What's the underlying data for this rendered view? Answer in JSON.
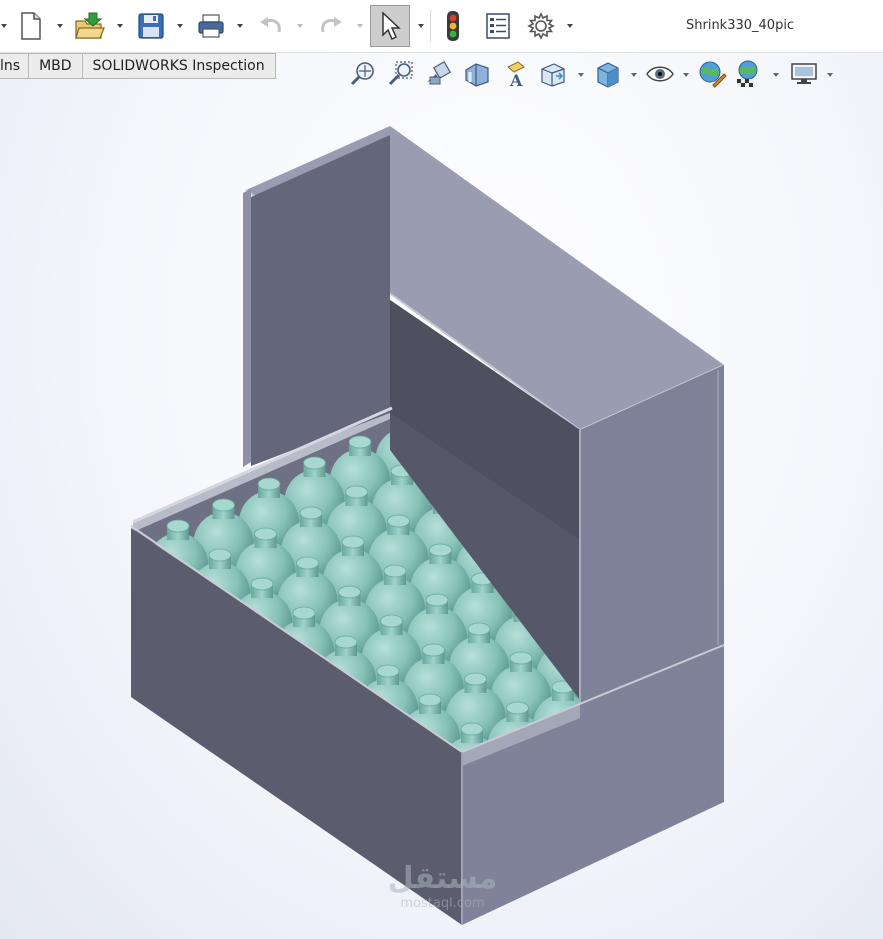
{
  "window": {
    "title": "Shrink330_40pic"
  },
  "toolbar": {
    "buttons": [
      {
        "name": "new-document",
        "icon": "new-document-icon"
      },
      {
        "name": "open",
        "icon": "open-folder-icon"
      },
      {
        "name": "save",
        "icon": "save-icon"
      },
      {
        "name": "print",
        "icon": "print-icon"
      },
      {
        "name": "undo",
        "icon": "undo-icon"
      },
      {
        "name": "redo",
        "icon": "redo-icon"
      },
      {
        "name": "select",
        "icon": "pointer-icon"
      },
      {
        "name": "rebuild",
        "icon": "traffic-light-icon"
      },
      {
        "name": "file-properties",
        "icon": "properties-list-icon"
      },
      {
        "name": "options",
        "icon": "gear-icon"
      }
    ]
  },
  "tabs": [
    {
      "label": "lns"
    },
    {
      "label": "MBD"
    },
    {
      "label": "SOLIDWORKS Inspection"
    }
  ],
  "view_toolbar": {
    "icons": [
      "zoom-to-fit-icon",
      "zoom-to-area-icon",
      "previous-view-icon",
      "section-view-icon",
      "dynamic-annotation-icon",
      "view-orientation-icon",
      "display-style-icon",
      "hide-show-icon",
      "edit-appearance-icon",
      "apply-scene-icon",
      "view-settings-icon"
    ]
  },
  "colors": {
    "box_top": "#9a9db0",
    "box_front": "#7c7f95",
    "box_side": "#5a5c6c",
    "bottle": "#86c1b8",
    "bottle_shade": "#5e9d93"
  },
  "watermark": {
    "arabic": "مستقل",
    "latin": "mostaql.com"
  }
}
